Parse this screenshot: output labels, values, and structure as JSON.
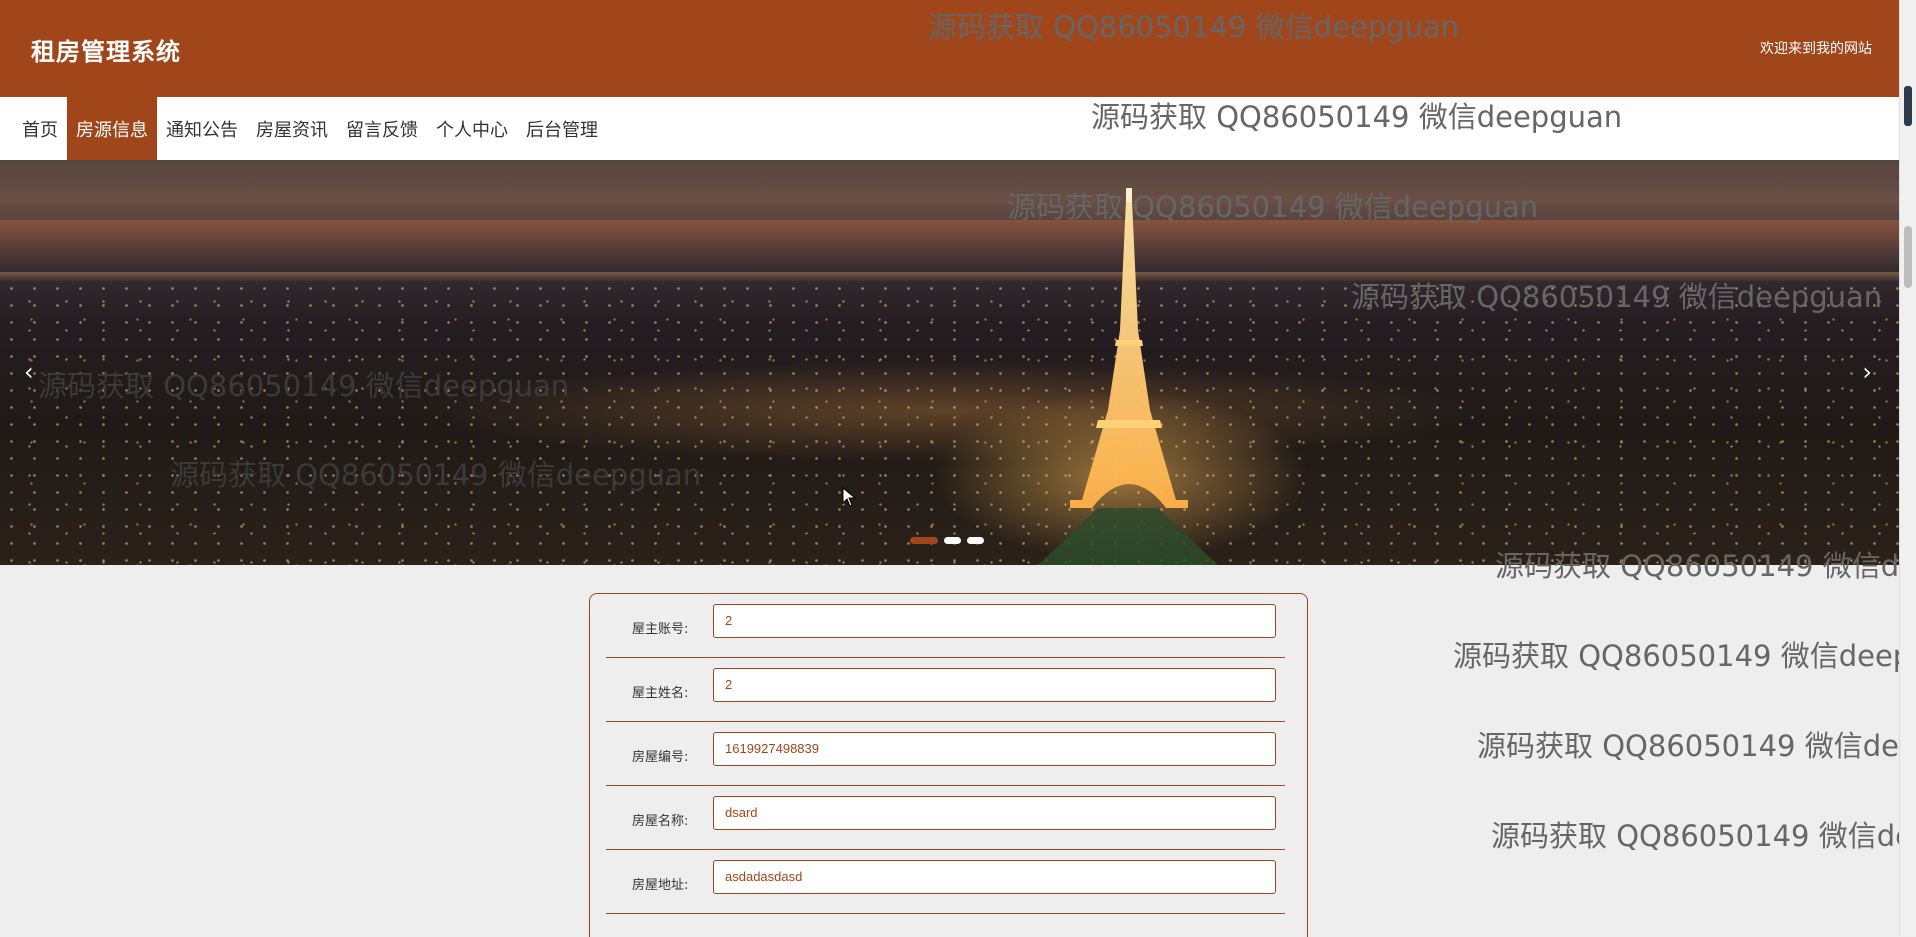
{
  "header": {
    "brand": "租房管理系统",
    "welcome": "欢迎来到我的网站",
    "bg_color": "#a1451b"
  },
  "nav": {
    "items": [
      {
        "label": "首页"
      },
      {
        "label": "房源信息"
      },
      {
        "label": "通知公告"
      },
      {
        "label": "房屋资讯"
      },
      {
        "label": "留言反馈"
      },
      {
        "label": "个人中心"
      },
      {
        "label": "后台管理"
      }
    ],
    "active_label": "房源信息"
  },
  "banner": {
    "prev_glyph": "‹",
    "next_glyph": "›",
    "slide_count": 3,
    "active_slide": 1
  },
  "watermark": {
    "text": "源码获取 QQ86050149 微信deepguan"
  },
  "form": {
    "fields": [
      {
        "label": "屋主账号:",
        "value": "2"
      },
      {
        "label": "屋主姓名:",
        "value": "2"
      },
      {
        "label": "房屋编号:",
        "value": "1619927498839"
      },
      {
        "label": "房屋名称:",
        "value": "dsard"
      },
      {
        "label": "房屋地址:",
        "value": "asdadasdasd"
      }
    ]
  },
  "icons": {
    "prev": "chevron-left-icon",
    "next": "chevron-right-icon",
    "cursor": "mouse-pointer-icon"
  }
}
